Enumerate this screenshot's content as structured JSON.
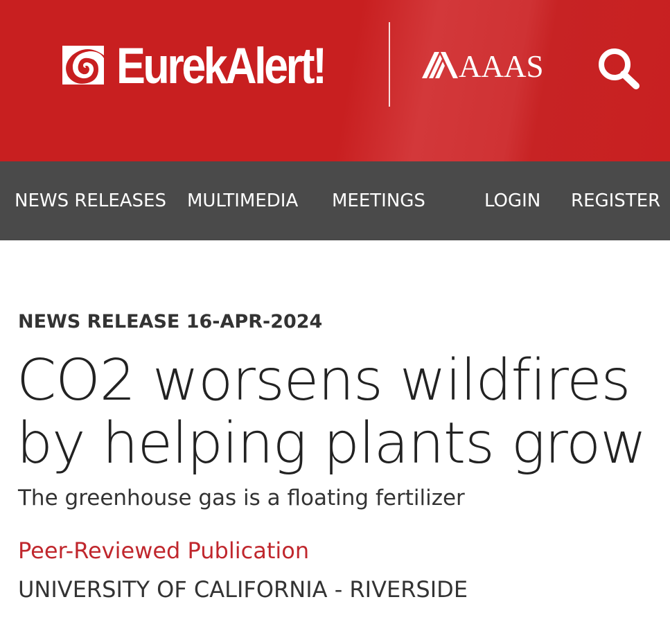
{
  "header": {
    "brand_name": "EurekAlert!",
    "partner_name": "AAAS",
    "icons": {
      "logo": "eurekalert-swirl-icon",
      "partner": "aaas-mark-icon",
      "search": "search-icon"
    },
    "colors": {
      "background": "#c81f20",
      "text": "#ffffff"
    }
  },
  "nav": {
    "background": "#4a4a4a",
    "items": [
      {
        "label": "NEWS RELEASES"
      },
      {
        "label": "MULTIMEDIA"
      },
      {
        "label": "MEETINGS"
      },
      {
        "label": "LOGIN"
      },
      {
        "label": "REGISTER"
      }
    ]
  },
  "article": {
    "meta": "NEWS RELEASE 16-APR-2024",
    "title_lines": [
      "CO2 worsens wildfires",
      "by helping plants grow"
    ],
    "subtitle": "The greenhouse gas is a floating fertilizer",
    "publication_type": "Peer-Reviewed Publication",
    "institution": "UNIVERSITY OF CALIFORNIA - RIVERSIDE",
    "colors": {
      "publication_type": "#c0272d",
      "text": "#333333"
    }
  }
}
